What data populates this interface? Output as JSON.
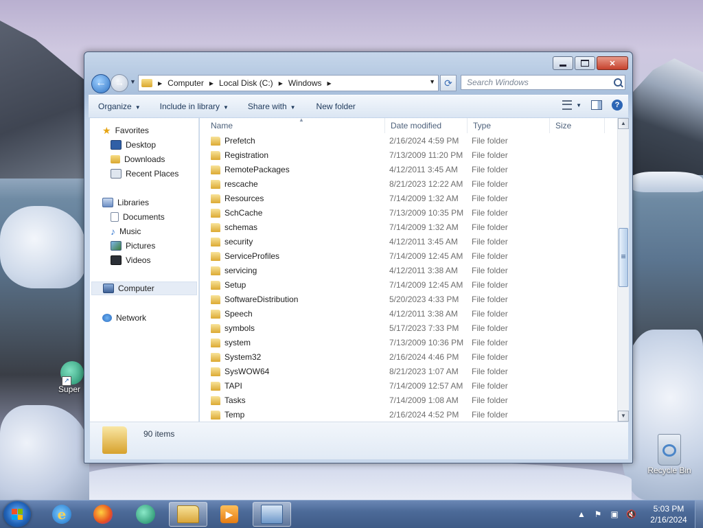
{
  "desktop": {
    "icons": {
      "recycle_bin": "Recycle Bin",
      "superhuman_partial": "Super"
    }
  },
  "window": {
    "address": {
      "crumbs": [
        "Computer",
        "Local Disk (C:)",
        "Windows"
      ]
    },
    "search": {
      "placeholder": "Search Windows"
    },
    "toolbar": {
      "organize": "Organize",
      "include_in_library": "Include in library",
      "share_with": "Share with",
      "new_folder": "New folder"
    },
    "nav": {
      "favorites": "Favorites",
      "desktop": "Desktop",
      "downloads": "Downloads",
      "recent_places": "Recent Places",
      "libraries": "Libraries",
      "documents": "Documents",
      "music": "Music",
      "pictures": "Pictures",
      "videos": "Videos",
      "computer": "Computer",
      "network": "Network"
    },
    "columns": {
      "name": "Name",
      "date_modified": "Date modified",
      "type": "Type",
      "size": "Size"
    },
    "files": [
      {
        "name": "Prefetch",
        "date": "2/16/2024 4:59 PM",
        "type": "File folder"
      },
      {
        "name": "Registration",
        "date": "7/13/2009 11:20 PM",
        "type": "File folder"
      },
      {
        "name": "RemotePackages",
        "date": "4/12/2011 3:45 AM",
        "type": "File folder"
      },
      {
        "name": "rescache",
        "date": "8/21/2023 12:22 AM",
        "type": "File folder"
      },
      {
        "name": "Resources",
        "date": "7/14/2009 1:32 AM",
        "type": "File folder"
      },
      {
        "name": "SchCache",
        "date": "7/13/2009 10:35 PM",
        "type": "File folder"
      },
      {
        "name": "schemas",
        "date": "7/14/2009 1:32 AM",
        "type": "File folder"
      },
      {
        "name": "security",
        "date": "4/12/2011 3:45 AM",
        "type": "File folder"
      },
      {
        "name": "ServiceProfiles",
        "date": "7/14/2009 12:45 AM",
        "type": "File folder"
      },
      {
        "name": "servicing",
        "date": "4/12/2011 3:38 AM",
        "type": "File folder"
      },
      {
        "name": "Setup",
        "date": "7/14/2009 12:45 AM",
        "type": "File folder"
      },
      {
        "name": "SoftwareDistribution",
        "date": "5/20/2023 4:33 PM",
        "type": "File folder"
      },
      {
        "name": "Speech",
        "date": "4/12/2011 3:38 AM",
        "type": "File folder"
      },
      {
        "name": "symbols",
        "date": "5/17/2023 7:33 PM",
        "type": "File folder"
      },
      {
        "name": "system",
        "date": "7/13/2009 10:36 PM",
        "type": "File folder"
      },
      {
        "name": "System32",
        "date": "2/16/2024 4:46 PM",
        "type": "File folder"
      },
      {
        "name": "SysWOW64",
        "date": "8/21/2023 1:07 AM",
        "type": "File folder"
      },
      {
        "name": "TAPI",
        "date": "7/14/2009 12:57 AM",
        "type": "File folder"
      },
      {
        "name": "Tasks",
        "date": "7/14/2009 1:08 AM",
        "type": "File folder"
      },
      {
        "name": "Temp",
        "date": "2/16/2024 4:52 PM",
        "type": "File folder"
      }
    ],
    "status": {
      "item_count": "90 items"
    }
  },
  "taskbar": {
    "time": "5:03 PM",
    "date": "2/16/2024"
  }
}
